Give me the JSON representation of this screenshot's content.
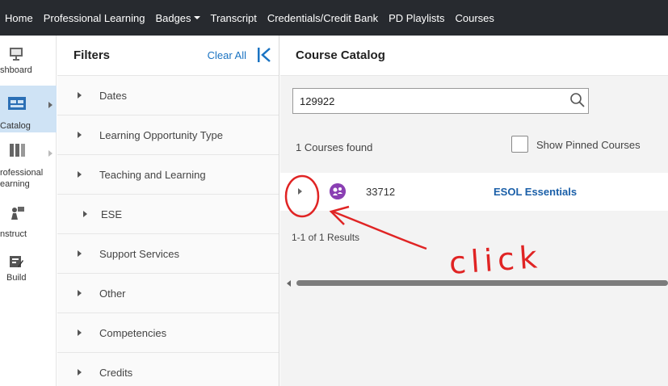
{
  "topnav": {
    "items": [
      {
        "label": "Home"
      },
      {
        "label": "Professional Learning"
      },
      {
        "label": "Badges"
      },
      {
        "label": "Transcript"
      },
      {
        "label": "Credentials/Credit Bank"
      },
      {
        "label": "PD Playlists"
      },
      {
        "label": "Courses"
      }
    ]
  },
  "rail": {
    "items": [
      {
        "label": "shboard",
        "icon": "dashboard-icon"
      },
      {
        "label": "Catalog",
        "icon": "catalog-icon",
        "active": true
      },
      {
        "label": "rofessional",
        "label2": "earning",
        "icon": "professional-learning-icon"
      },
      {
        "label": "nstruct",
        "icon": "instruct-icon"
      },
      {
        "label": "Build",
        "icon": "build-icon"
      }
    ]
  },
  "filters": {
    "title": "Filters",
    "clear_all": "Clear All",
    "items": [
      {
        "label": "Dates"
      },
      {
        "label": "Learning Opportunity Type"
      },
      {
        "label": "Teaching and Learning"
      },
      {
        "label": "ESE"
      },
      {
        "label": "Support Services"
      },
      {
        "label": "Other"
      },
      {
        "label": "Competencies"
      },
      {
        "label": "Credits"
      }
    ]
  },
  "catalog": {
    "title": "Course Catalog",
    "search_value": "129922",
    "found_text": "1 Courses found",
    "pinned_label": "Show Pinned Courses",
    "course": {
      "id": "33712",
      "name": "ESOL Essentials"
    },
    "results_text": "1-1 of 1 Results"
  },
  "annotation": {
    "text": "click",
    "color": "#e02424"
  },
  "colors": {
    "topnav_bg": "#272a2f",
    "active_rail_bg": "#cfe3f5",
    "link": "#1a73c2",
    "badge": "#8a3fb3"
  }
}
